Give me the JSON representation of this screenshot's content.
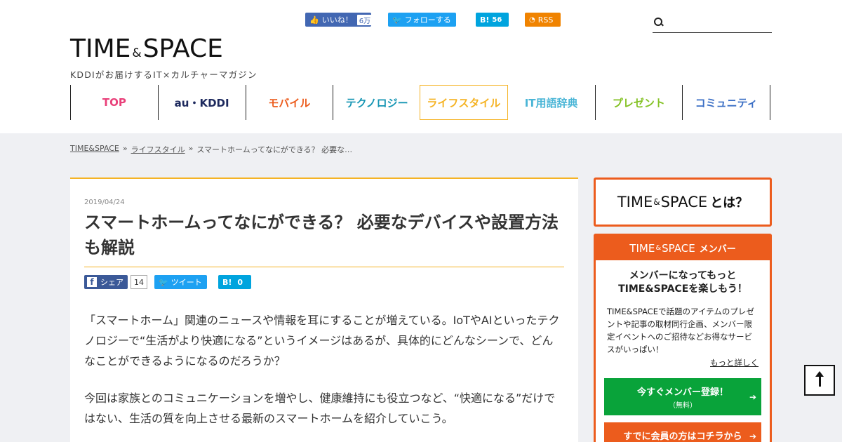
{
  "header": {
    "social": {
      "fb_like_label": "いいね！",
      "fb_like_count": "6万",
      "tw_follow_label": "フォローする",
      "hatena_label": "B!",
      "hatena_count": "56",
      "rss_label": "RSS"
    },
    "search": {
      "placeholder": ""
    },
    "logo": {
      "main_left": "TIME",
      "amp": "&",
      "main_right": "SPACE",
      "tagline": "KDDIがお届けするIT×カルチャーマガジン"
    },
    "nav": [
      {
        "label": "TOP",
        "color": "#e9407a"
      },
      {
        "label": "au・KDDI",
        "color": "#1e2a5e"
      },
      {
        "label": "モバイル",
        "color": "#ec5c1d"
      },
      {
        "label": "テクノロジー",
        "color": "#1595b3"
      },
      {
        "label": "ライフスタイル",
        "color": "#f5b324",
        "active": true
      },
      {
        "label": "IT用語辞典",
        "color": "#49b5d6"
      },
      {
        "label": "プレゼント",
        "color": "#84c225"
      },
      {
        "label": "コミュニティ",
        "color": "#3b6fc5"
      }
    ]
  },
  "breadcrumb": {
    "home": "TIME&SPACE",
    "sep": "»",
    "category": "ライフスタイル",
    "current": "スマートホームってなにができる？ 必要な…"
  },
  "article": {
    "date": "2019/04/24",
    "title": "スマートホームってなにができる？ 必要なデバイスや設置方法も解説",
    "share": {
      "fb_label": "シェア",
      "fb_count": "14",
      "tw_label": "ツイート",
      "hatena_label": "B!",
      "hatena_count": "0"
    },
    "para1": "「スマートホーム」関連のニュースや情報を耳にすることが増えている。IoTやAIといったテクノロジーで“生活がより快適になる”というイメージはあるが、具体的にどんなシーンで、どんなことができるようになるのだろうか？",
    "para2": "今回は家族とのコミュニケーションを増やし、健康維持にも役立つなど、“快適になる”だけではない、生活の質を向上させる最新のスマートホームを紹介していこう。"
  },
  "sidebar": {
    "about": {
      "left": "TIME",
      "amp": "&",
      "right": "SPACE",
      "suffix": "とは？"
    },
    "member": {
      "head_left": "TIME",
      "head_amp": "&",
      "head_right": "SPACE",
      "head_suffix": "メンバー",
      "lead_line1": "メンバーになってもっと",
      "lead_line2": "TIME&SPACEを楽しもう！",
      "desc": "TIME&SPACEで話題のアイテムのプレゼントや記事の取材同行企画、メンバー限定イベントへのご招待などお得なサービスがいっぱい！",
      "more": "もっと詳しく",
      "register_main": "今すぐメンバー登録！",
      "register_sub": "（無料）",
      "login": "すでに会員の方はコチラから",
      "arrow": "➔"
    }
  },
  "colors": {
    "accent": "#f5b324",
    "brand_orange": "#ec5c1d",
    "green": "#09a33a"
  }
}
